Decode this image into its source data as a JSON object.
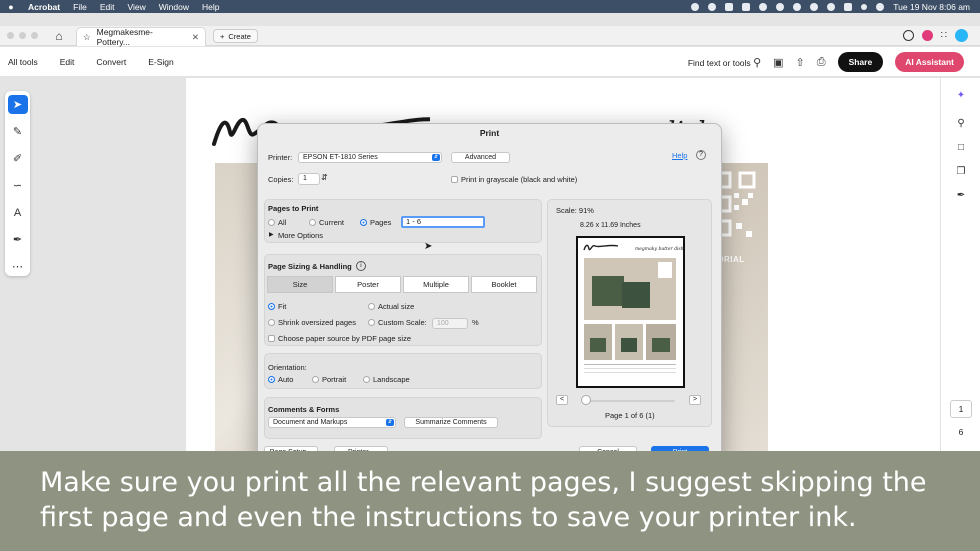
{
  "menubar": {
    "app": "Acrobat",
    "items": [
      "File",
      "Edit",
      "View",
      "Window",
      "Help"
    ],
    "clock": "Tue 19 Nov  8:06 am"
  },
  "tabbar": {
    "tab_title": "Megmakesme-Pottery...",
    "new_tab_label": "Create"
  },
  "toolbar": {
    "menus": [
      "All tools",
      "Edit",
      "Convert",
      "E-Sign"
    ],
    "find_label": "Find text or tools",
    "share_label": "Share",
    "ai_label": "AI Assistant"
  },
  "document": {
    "title_fragment": "r dish",
    "tutorial_label": "TORIAL"
  },
  "print_dialog": {
    "title": "Print",
    "printer_label": "Printer:",
    "printer_value": "EPSON ET-1810 Series",
    "advanced_label": "Advanced",
    "help_label": "Help",
    "copies_label": "Copies:",
    "copies_value": "1",
    "grayscale_label": "Print in grayscale (black and white)",
    "pages_heading": "Pages to Print",
    "pages_options": [
      "All",
      "Current",
      "Pages"
    ],
    "pages_value": "1 - 6",
    "more_options": "More Options",
    "sizing_heading": "Page Sizing & Handling",
    "sizing_tabs": [
      "Size",
      "Poster",
      "Multiple",
      "Booklet"
    ],
    "fit_label": "Fit",
    "actual_size_label": "Actual size",
    "shrink_label": "Shrink oversized pages",
    "custom_scale_label": "Custom Scale:",
    "custom_scale_value": "100",
    "percent": "%",
    "paper_source_label": "Choose paper source by PDF page size",
    "orientation_heading": "Orientation:",
    "orientation_options": [
      "Auto",
      "Portrait",
      "Landscape"
    ],
    "comments_heading": "Comments & Forms",
    "comments_value": "Document and Markups",
    "summarize_label": "Summarize Comments",
    "scale_label": "Scale:  91%",
    "paper_size": "8.26 x 11.69 Inches",
    "page_counter": "Page 1 of 6 (1)",
    "preview_title": "megmaky butter dish",
    "bottom_buttons": [
      "Page Setup...",
      "Printer...",
      "Cancel",
      "Print"
    ]
  },
  "page_nav": {
    "current": "1",
    "total": "6"
  },
  "caption": {
    "text": "Make sure you print all the relevant pages, I suggest skipping the first page and even the instructions to save your printer ink."
  },
  "colors": {
    "accent": "#1a73e8",
    "ai_pink": "#e0476e",
    "caption_bg": "#8f9382",
    "menubar_bg": "#3d4f66"
  }
}
